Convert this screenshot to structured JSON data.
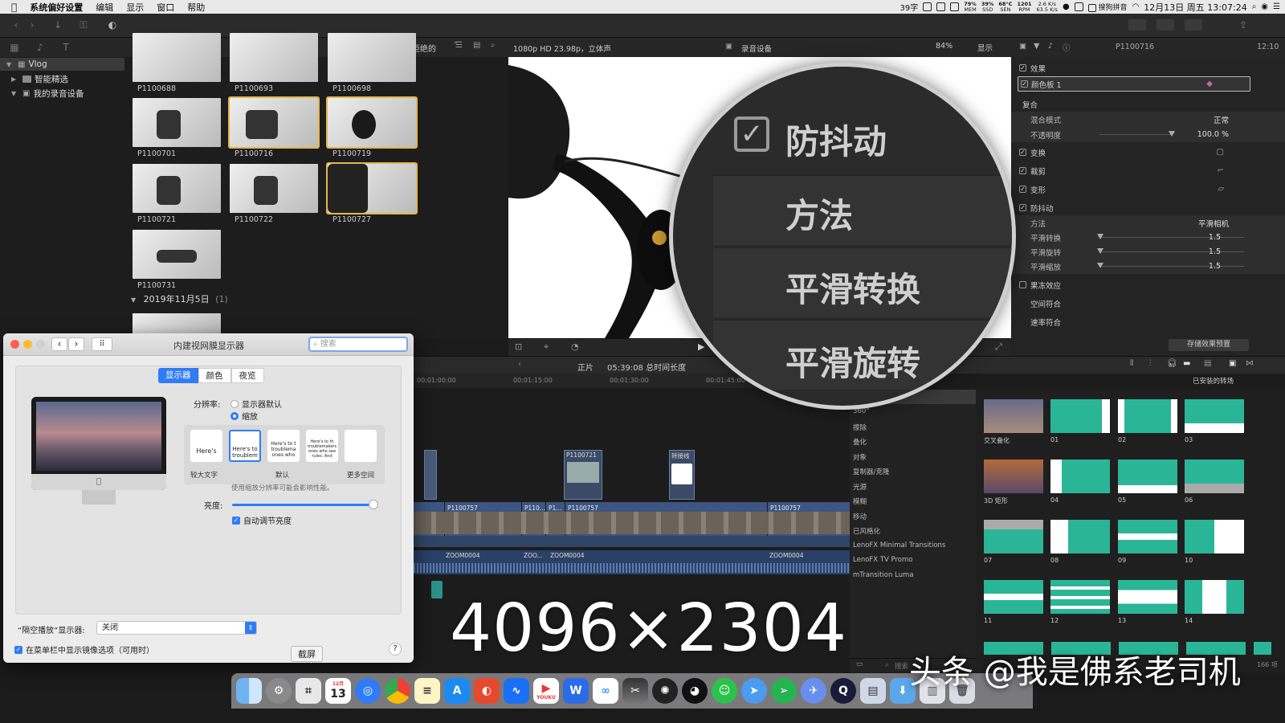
{
  "menubar": {
    "app_name": "系统偏好设置",
    "items": [
      "编辑",
      "显示",
      "窗口",
      "帮助"
    ],
    "status": {
      "count": "39字",
      "mem": "79%",
      "mem_label": "MEM",
      "ssd": "39%",
      "ssd_label": "SSD",
      "temp": "68°C",
      "temp_label": "SEN",
      "fan": "1201",
      "fan_label": "RPM",
      "net_up": "2.6 K/s",
      "net_down": "63.5 K/s",
      "ime": "搜狗拼音",
      "datetime": "12月13日 周五 13:07:24"
    }
  },
  "library": {
    "root": "Vlog",
    "items": [
      "智能精选",
      "我的录音设备"
    ]
  },
  "browser": {
    "filter_label": "隐藏被拒绝的",
    "clips_top": [
      "P1100688",
      "P1100693",
      "P1100698"
    ],
    "clips": [
      {
        "name": "P1100701",
        "selected": false
      },
      {
        "name": "P1100716",
        "selected": true
      },
      {
        "name": "P1100719",
        "selected": true
      },
      {
        "name": "P1100721",
        "selected": false
      },
      {
        "name": "P1100722",
        "selected": false
      },
      {
        "name": "P1100727",
        "selected": true
      },
      {
        "name": "P1100731",
        "selected": false
      }
    ],
    "date_group": "2019年11月5日",
    "date_group_count": "(1)"
  },
  "viewer": {
    "format": "1080p HD 23.98p，立体声",
    "project": "录音设备",
    "zoom": "84%",
    "view_label": "显示"
  },
  "magnifier": {
    "checkbox_label": "防抖动",
    "rows": [
      "方法",
      "平滑转换",
      "平滑旋转"
    ]
  },
  "inspector": {
    "clip_name": "P1100716",
    "duration": "12:10",
    "effects_label": "效果",
    "color_board": "颜色板 1",
    "composite": "复合",
    "blend_mode_label": "混合模式",
    "blend_mode_value": "正常",
    "opacity_label": "不透明度",
    "opacity_value": "100.0 %",
    "opacity_level": 1.0,
    "transform": "变换",
    "crop": "裁剪",
    "distort": "变形",
    "stabilization": "防抖动",
    "method_label": "方法",
    "method_value": "平滑相机",
    "smooth_rows": [
      {
        "label": "平滑转换",
        "value": "1.5"
      },
      {
        "label": "平滑旋转",
        "value": "1.5"
      },
      {
        "label": "平滑缩放",
        "value": "1.5"
      }
    ],
    "rolling_shutter": "果冻效应",
    "spatial_conform": "空间符合",
    "rate_conform": "速率符合",
    "save_preset": "存储效果预置"
  },
  "timeline": {
    "header_center": "正片",
    "duration": "05:39:08 总时间长度",
    "ruler": [
      "00:01:00:00",
      "00:01:15:00",
      "00:01:30:00",
      "00:01:45:00"
    ],
    "connected_clips": [
      "P1100721",
      "转接线"
    ],
    "main_clips": [
      "P1100757",
      "P110...",
      "P1...",
      "P1100757",
      "P1100757"
    ],
    "audio_clips": [
      "ZOOM0004",
      "ZOO...",
      "ZOOM0004",
      "ZOOM0004"
    ]
  },
  "transitions": {
    "header": "已安装的转场",
    "categories": [
      "360°",
      "擦除",
      "叠化",
      "对象",
      "复制器/克隆",
      "光源",
      "模糊",
      "移动",
      "已风格化",
      "LenoFX Minimal Transitions",
      "LenoFX TV Promo",
      "mTransition Luma"
    ],
    "items": [
      "交叉叠化",
      "01",
      "02",
      "03",
      "3D 矩形",
      "04",
      "05",
      "06",
      "07",
      "08",
      "09",
      "10",
      "11",
      "12",
      "13",
      "14"
    ],
    "search_placeholder": "搜索",
    "count": "166 项"
  },
  "prefs": {
    "title": "内建视网膜显示器",
    "search_placeholder": "搜索",
    "tabs": [
      "显示器",
      "颜色",
      "夜览"
    ],
    "resolution_label": "分辨率:",
    "res_options": [
      "显示器默认",
      "缩放"
    ],
    "scale_options": [
      "较大文字",
      "",
      "默认",
      "",
      "更多空间"
    ],
    "scale_preview_texts": [
      "Here's",
      "Here's to troublem",
      "Here's to t troublema ones who",
      "Here's to th troublemakers ones who see rules. And",
      ""
    ],
    "scale_note": "使用缩放分辨率可能会影响性能。",
    "brightness_label": "亮度:",
    "brightness_level": 0.98,
    "auto_brightness": "自动调节亮度",
    "airplay_label": "“隔空播放”显示器:",
    "airplay_value": "关闭",
    "mirror_option": "在菜单栏中显示镜像选项（可用时）",
    "help": "?"
  },
  "tooltip": "截屏",
  "overlay_resolution": "4096×2304",
  "watermark": "头条 @我是佛系老司机",
  "dock": {
    "calendar_month": "12月",
    "calendar_day": "13",
    "youku": "YOUKU"
  }
}
